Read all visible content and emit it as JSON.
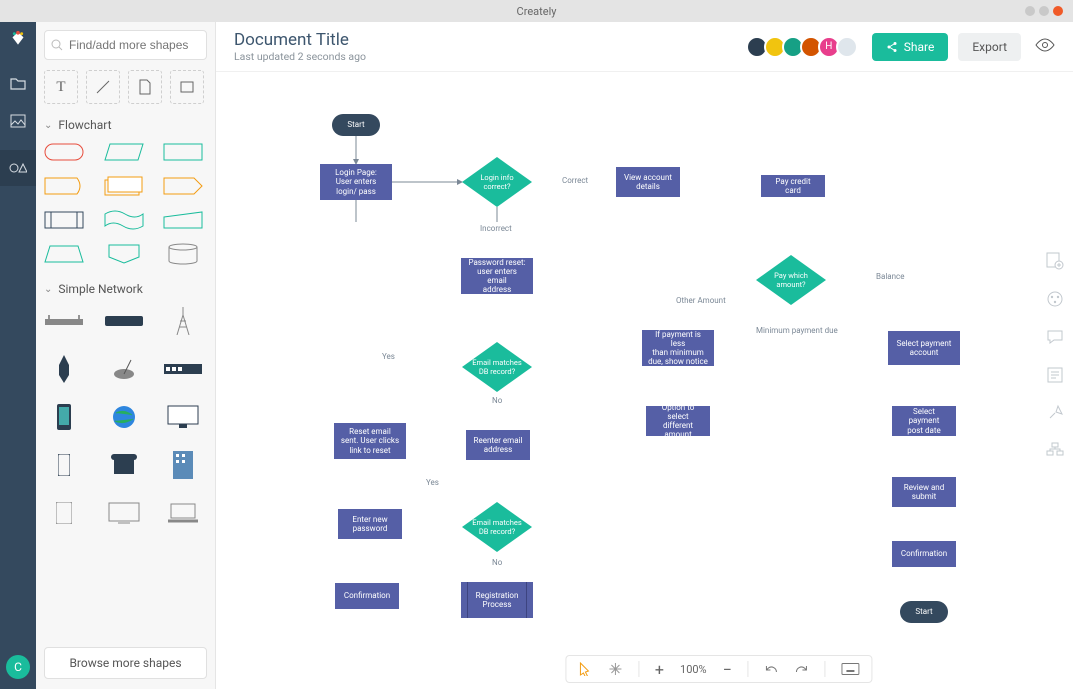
{
  "app": {
    "title": "Creately"
  },
  "leftrail": {
    "user_initial": "C"
  },
  "leftpanel": {
    "search_placeholder": "Find/add more shapes",
    "sections": {
      "flowchart": "Flowchart",
      "simplenet": "Simple Network"
    },
    "browse_more": "Browse more shapes"
  },
  "header": {
    "title": "Document Title",
    "subtitle": "Last updated 2 seconds ago",
    "share": "Share",
    "export": "Export",
    "avatars": [
      {
        "bg": "#2c3e50",
        "label": ""
      },
      {
        "bg": "#f1c40f",
        "label": ""
      },
      {
        "bg": "#16a085",
        "label": ""
      },
      {
        "bg": "#d35400",
        "label": ""
      },
      {
        "bg": "#e83e8c",
        "label": "H"
      },
      {
        "bg": "#dfe6ec",
        "label": ""
      }
    ]
  },
  "bottombar": {
    "zoom": "100%"
  },
  "flow": {
    "terminators": {
      "start": "Start",
      "end": "Start"
    },
    "processes": {
      "login": "Login Page:\nUser enters\nlogin/ pass",
      "view_account": "View account\ndetails",
      "pay_card": "Pay credit card",
      "pwd_reset": "Password reset:\nuser enters email\naddress",
      "reset_sent": "Reset email\nsent. User clicks\nlink to reset",
      "reenter_email": "Reenter email\naddress",
      "enter_new_pwd": "Enter new\npassword",
      "confirmation1": "Confirmation",
      "minimum_notice": "If payment is less\nthan minimum\ndue, show notice",
      "select_diff": "Option to select\ndifferent amount",
      "select_acct": "Select payment\naccount",
      "select_date": "Select payment\npost date",
      "review": "Review and\nsubmit",
      "confirmation2": "Confirmation"
    },
    "decisions": {
      "login_correct": "Login info\ncorrect?",
      "email_match1": "Email matches\nDB record?",
      "email_match2": "Email matches\nDB record?",
      "pay_which": "Pay which\namount?"
    },
    "predefined": {
      "registration": "Registration\nProcess"
    },
    "labels": {
      "correct": "Correct",
      "incorrect": "Incorrect",
      "yes1": "Yes",
      "no1": "No",
      "yes2": "Yes",
      "no2": "No",
      "other_amt": "Other Amount",
      "min_due": "Minimum payment due",
      "balance": "Balance"
    }
  }
}
